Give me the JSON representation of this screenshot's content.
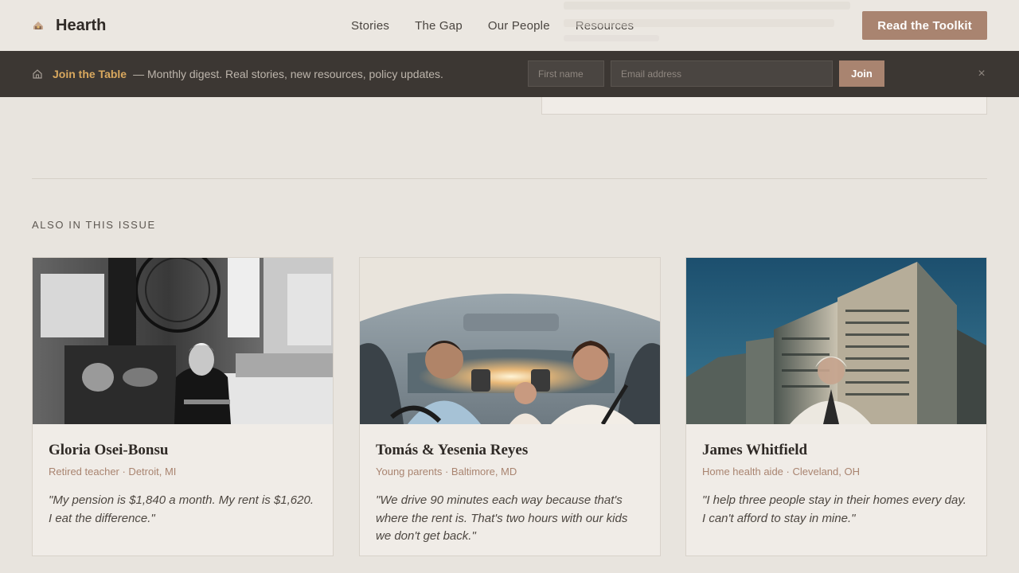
{
  "header": {
    "logo_text": "Hearth",
    "logo_icon": "hearth-logo-icon",
    "nav": [
      {
        "label": "Stories"
      },
      {
        "label": "The Gap"
      },
      {
        "label": "Our People"
      },
      {
        "label": "Resources"
      }
    ],
    "cta_label": "Read the Toolkit"
  },
  "banner": {
    "icon": "home-icon",
    "title": "Join the Table",
    "description": "— Monthly digest. Real stories, new resources, policy updates.",
    "first_name_placeholder": "First name",
    "email_placeholder": "Email address",
    "join_label": "Join",
    "close_label": "×"
  },
  "section": {
    "label": "ALSO IN THIS ISSUE"
  },
  "cards": [
    {
      "name": "Gloria Osei-Bonsu",
      "meta": "Retired teacher · Detroit, MI",
      "quote": "\"My pension is $1,840 a month. My rent is $1,620. I eat the difference.\""
    },
    {
      "name": "Tomás & Yesenia Reyes",
      "meta": "Young parents · Baltimore, MD",
      "quote": "\"We drive 90 minutes each way because that's where the rent is. That's two hours with our kids we don't get back.\""
    },
    {
      "name": "James Whitfield",
      "meta": "Home health aide · Cleveland, OH",
      "quote": "\"I help three people stay in their homes every day. I can't afford to stay in mine.\""
    }
  ],
  "colors": {
    "accent": "#a98470",
    "banner_bg": "#3c3733",
    "banner_title": "#d9a85e",
    "page_bg": "#e8e4de"
  }
}
